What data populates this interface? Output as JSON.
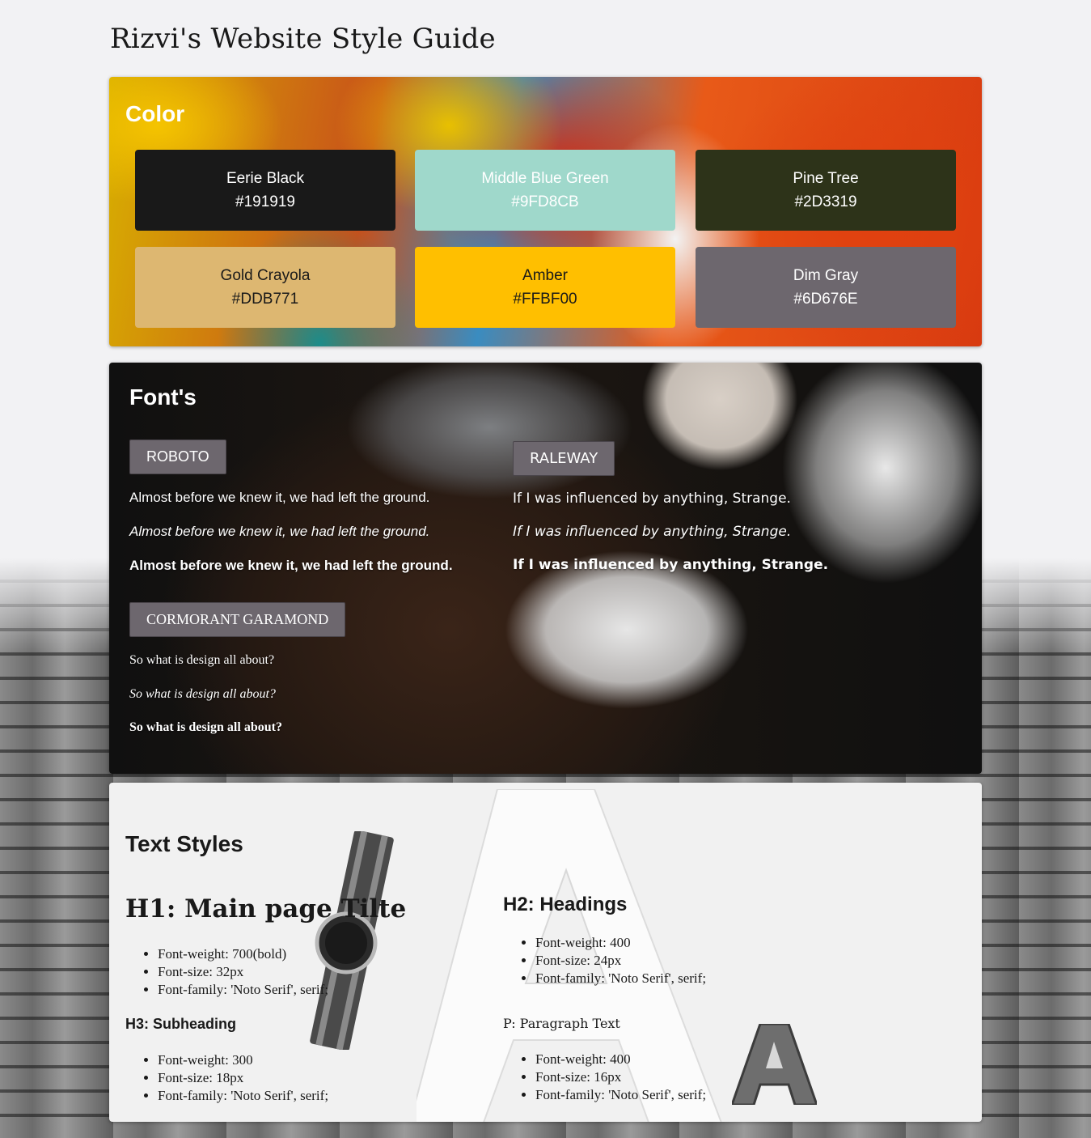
{
  "page": {
    "title": "Rizvi's Website Style Guide"
  },
  "color_section": {
    "title": "Color",
    "swatches": [
      {
        "name": "Eerie Black",
        "hex": "#191919",
        "text_color": "#ffffff"
      },
      {
        "name": "Middle Blue Green",
        "hex": "#9FD8CB",
        "text_color": "#ffffff"
      },
      {
        "name": "Pine Tree",
        "hex": "#2D3319",
        "text_color": "#ffffff"
      },
      {
        "name": "Gold Crayola",
        "hex": "#DDB771",
        "text_color": "#191919"
      },
      {
        "name": "Amber",
        "hex": "#FFBF00",
        "text_color": "#191919"
      },
      {
        "name": "Dim Gray",
        "hex": "#6D676E",
        "text_color": "#ffffff"
      }
    ]
  },
  "fonts_section": {
    "title": "Font's",
    "roboto": {
      "label": "ROBOTO",
      "regular": "Almost before we knew it, we had left the ground.",
      "italic": "Almost before we knew it, we had left the ground.",
      "bold": "Almost before we knew it, we had left the ground."
    },
    "raleway": {
      "label": "RALEWAY",
      "regular": "If I was influenced by anything, Strange.",
      "italic": "If I was influenced by anything, Strange.",
      "bold": "If I was influenced by anything, Strange."
    },
    "garamond": {
      "label": "CORMORANT GARAMOND",
      "regular": "So what is design all about?",
      "italic": "So what is design all about?",
      "bold": "So what is design all about?"
    }
  },
  "text_styles": {
    "title": "Text Styles",
    "h1": {
      "heading": "H1: Main page Tilte",
      "props": [
        "Font-weight: 700(bold)",
        "Font-size: 32px",
        "Font-family: 'Noto Serif', serif;"
      ]
    },
    "h2": {
      "heading": "H2: Headings",
      "props": [
        "Font-weight: 400",
        "Font-size: 24px",
        "Font-family: 'Noto Serif', serif;"
      ]
    },
    "h3": {
      "heading": "H3: Subheading",
      "props": [
        "Font-weight: 300",
        "Font-size: 18px",
        "Font-family: 'Noto Serif', serif;"
      ]
    },
    "p": {
      "heading": "P: Paragraph Text",
      "props": [
        "Font-weight: 400",
        "Font-size: 16px",
        "Font-family: 'Noto Serif', serif;"
      ]
    }
  }
}
